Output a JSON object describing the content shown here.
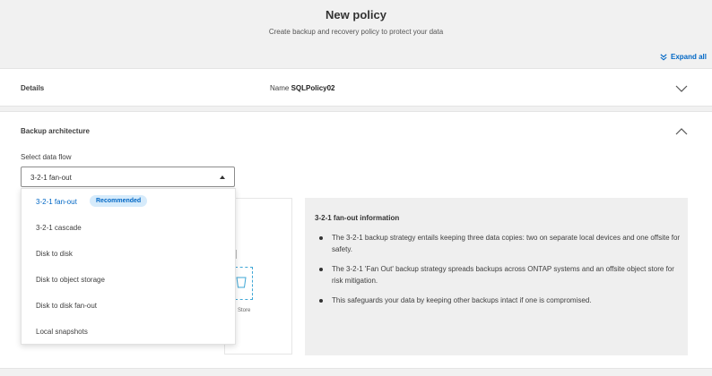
{
  "header": {
    "title": "New policy",
    "subtitle": "Create backup and recovery policy to protect your data"
  },
  "toolbar": {
    "expand_all": "Expand all"
  },
  "details": {
    "label": "Details",
    "name_label": "Name",
    "name_value": "SQLPolicy02"
  },
  "architecture": {
    "label": "Backup architecture",
    "flow_label": "Select data flow",
    "selected": "3-2-1 fan-out",
    "options": [
      {
        "label": "3-2-1 fan-out",
        "badge": "Recommended"
      },
      {
        "label": "3-2-1 cascade"
      },
      {
        "label": "Disk to disk"
      },
      {
        "label": "Disk to object storage"
      },
      {
        "label": "Disk to disk fan-out"
      },
      {
        "label": "Local snapshots"
      }
    ],
    "diagram_store_label": "Store"
  },
  "info": {
    "title": "3-2-1 fan-out information",
    "bullets": [
      "The 3-2-1 backup strategy entails keeping three data copies: two on separate local devices and one offsite for safety.",
      "The 3-2-1 'Fan Out' backup strategy spreads backups across ONTAP systems and an offsite object store for risk mitigation.",
      "This safeguards your data by keeping other backups intact if one is compromised."
    ]
  },
  "colors": {
    "accent": "#0067c5",
    "badge_bg": "#d6ebfb",
    "page_bg": "#f1f1f1"
  }
}
